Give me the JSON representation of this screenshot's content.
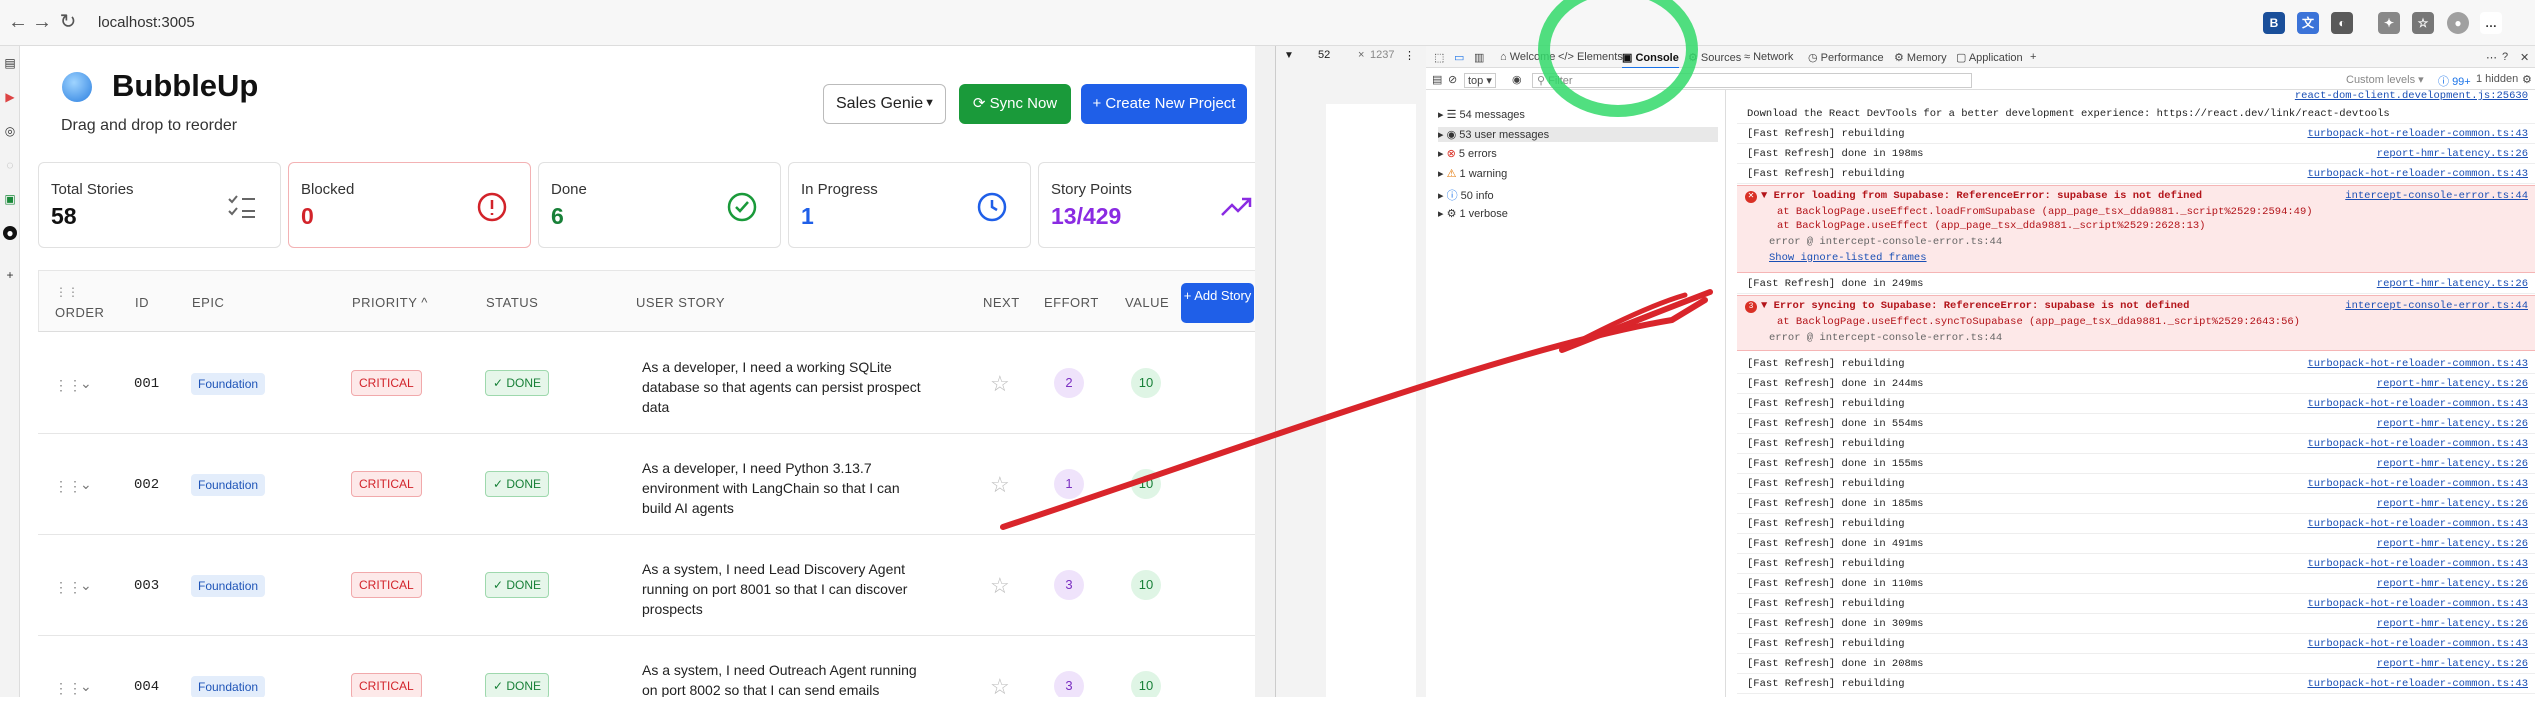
{
  "browser": {
    "url": "localhost:3005"
  },
  "app": {
    "title": "BubbleUp",
    "subtitle": "Drag and drop to reorder",
    "select_value": "Sales Genie",
    "sync_label": "Sync Now",
    "create_label": "+ Create New Project"
  },
  "stats": [
    {
      "label": "Total Stories",
      "value": "58",
      "color": "#111111"
    },
    {
      "label": "Blocked",
      "value": "0",
      "color": "#d2232a"
    },
    {
      "label": "Done",
      "value": "6",
      "color": "#188038"
    },
    {
      "label": "In Progress",
      "value": "1",
      "color": "#1f5fe8"
    },
    {
      "label": "Story Points",
      "value": "13/429",
      "color": "#8a2be2"
    }
  ],
  "table": {
    "headers": {
      "order": "ORDER",
      "id": "ID",
      "epic": "EPIC",
      "priority": "PRIORITY ^",
      "status": "STATUS",
      "story": "USER STORY",
      "next": "NEXT",
      "effort": "EFFORT",
      "value": "VALUE"
    },
    "add_label": "+ Add Story",
    "rows": [
      {
        "id": "001",
        "epic": "Foundation",
        "priority": "CRITICAL",
        "status": "DONE",
        "story": "As a developer, I need a working SQLite database so that agents can persist prospect data",
        "effort": "2",
        "value": "10"
      },
      {
        "id": "002",
        "epic": "Foundation",
        "priority": "CRITICAL",
        "status": "DONE",
        "story": "As a developer, I need Python 3.13.7 environment with LangChain so that I can build AI agents",
        "effort": "1",
        "value": "10"
      },
      {
        "id": "003",
        "epic": "Foundation",
        "priority": "CRITICAL",
        "status": "DONE",
        "story": "As a system, I need Lead Discovery Agent running on port 8001 so that I can discover prospects",
        "effort": "3",
        "value": "10"
      },
      {
        "id": "004",
        "epic": "Foundation",
        "priority": "CRITICAL",
        "status": "DONE",
        "story": "As a system, I need Outreach Agent running on port 8002 so that I can send emails",
        "effort": "3",
        "value": "10"
      }
    ]
  },
  "devtools": {
    "device_w": "52",
    "device_h": "1237",
    "tabs": {
      "welcome": "Welcome",
      "elements": "Elements",
      "console": "Console",
      "sources": "Sources",
      "network": "Network",
      "performance": "Performance",
      "memory": "Memory",
      "application": "Application"
    },
    "context": "top",
    "filter_placeholder": "Filter",
    "levels": "Custom levels",
    "count_badge": "99+",
    "hidden": "1 hidden",
    "sidebar": {
      "messages": "54 messages",
      "user_messages": "53 user messages",
      "errors": "5 errors",
      "warning": "1 warning",
      "info": "50 info",
      "verbose": "1 verbose"
    },
    "console": {
      "react_src": "react-dom-client.development.js:25630",
      "react_msg": "Download the React DevTools for a better development experience: https://react.dev/link/react-devtools",
      "rebuilding": "[Fast Refresh] rebuilding",
      "src_rebuild": "turbopack-hot-reloader-common.ts:43",
      "src_done": "report-hmr-latency.ts:26",
      "done_198": "[Fast Refresh] done in 198ms",
      "done_249": "[Fast Refresh] done in 249ms",
      "done_244": "[Fast Refresh] done in 244ms",
      "done_554": "[Fast Refresh] done in 554ms",
      "done_155": "[Fast Refresh] done in 155ms",
      "done_185": "[Fast Refresh] done in 185ms",
      "done_491": "[Fast Refresh] done in 491ms",
      "done_110": "[Fast Refresh] done in 110ms",
      "done_309": "[Fast Refresh] done in 309ms",
      "done_208": "[Fast Refresh] done in 208ms",
      "err1": "Error loading from Supabase: ReferenceError: supabase is not defined",
      "err1_src": "intercept-console-error.ts:44",
      "err1_a": "at BacklogPage.useEffect.loadFromSupabase (app_page_tsx_dda9881._script%2529:2594:49)",
      "err1_b": "at BacklogPage.useEffect (app_page_tsx_dda9881._script%2529:2628:13)",
      "err1_c": "error @ intercept-console-error.ts:44",
      "err1_d": "Show ignore-listed frames",
      "err2": "Error syncing to Supabase: ReferenceError: supabase is not defined",
      "err2_src": "intercept-console-error.ts:44",
      "err2_a": "at BacklogPage.useEffect.syncToSupabase (app_page_tsx_dda9881._script%2529:2643:56)",
      "err2_b": "error @ intercept-console-error.ts:44",
      "err2_count": "3"
    }
  }
}
